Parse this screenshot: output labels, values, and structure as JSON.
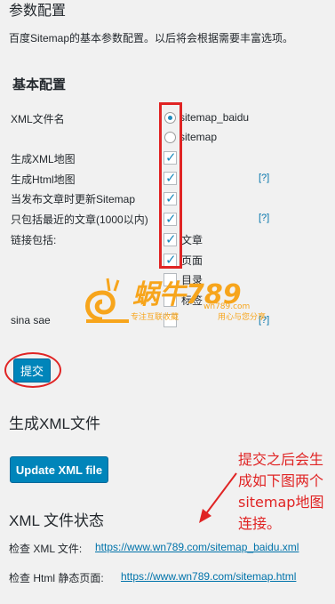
{
  "page": {
    "title": "参数配置",
    "description": "百度Sitemap的基本参数配置。以后将会根据需要丰富选项。"
  },
  "basic": {
    "heading": "基本配置",
    "xml_name_label": "XML文件名",
    "radio_options": [
      "sitemap_baidu",
      "sitemap"
    ],
    "selected_radio": "sitemap_baidu",
    "gen_xml_label": "生成XML地图",
    "gen_html_label": "生成Html地图",
    "update_on_publish_label": "当发布文章时更新Sitemap",
    "recent_only_label": "只包括最近的文章(1000以内)",
    "links_label": "链接包括:",
    "link_options": [
      "文章",
      "页面",
      "目录",
      "标签"
    ],
    "help": "[?]",
    "sina_label": "sina sae"
  },
  "submit_button": "提交",
  "generate": {
    "heading": "生成XML文件",
    "update_button": "Update XML file"
  },
  "status": {
    "heading": "XML 文件状态",
    "xml_check_label": "检查 XML 文件:",
    "xml_url": "https://www.wn789.com/sitemap_baidu.xml",
    "html_check_label": "检查 Html 静态页面:",
    "html_url": "https://www.wn789.com/sitemap.html"
  },
  "annotation": {
    "note": "提交之后会生成如下图两个sitemap地图连接。"
  },
  "watermark": {
    "brand": "蜗牛789",
    "domain": "wn789.com",
    "slogan_left": "专注互联收藏",
    "slogan_right": "用心与您分享"
  },
  "colors": {
    "accent": "#0073aa",
    "primary_button": "#0085ba",
    "annotation": "#e02424",
    "watermark": "#f7a51c"
  }
}
